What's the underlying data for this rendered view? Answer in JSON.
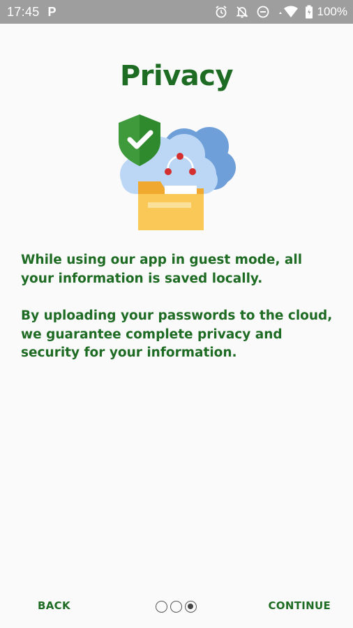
{
  "status_bar": {
    "time": "17:45",
    "app_icon_glyph": "P",
    "battery_percent": "100%",
    "icons": [
      "alarm-icon",
      "notifications-off-icon",
      "do-not-disturb-icon",
      "wifi-icon",
      "battery-icon"
    ]
  },
  "title": "Privacy",
  "illustration": {
    "icon": "cloud-folder-shield-illustration",
    "colors": {
      "shield": "#3f9a3c",
      "cloud_light": "#bcd7f5",
      "cloud_dark": "#6e9fd8",
      "folder": "#f6b83c",
      "folder_front": "#f9c857",
      "network_nodes": "#d32f2f"
    }
  },
  "paragraphs": [
    "While using our app in guest mode, all your information is saved locally.",
    "By uploading your passwords to the cloud, we guarantee complete privacy and security for your information."
  ],
  "navigation": {
    "back_label": "BACK",
    "continue_label": "CONTINUE",
    "page_count": 3,
    "current_page": 3
  },
  "colors": {
    "accent": "#1e6b23",
    "background": "#fafafa",
    "status_bar": "#9e9e9e"
  }
}
